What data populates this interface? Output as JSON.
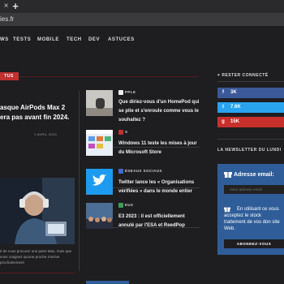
{
  "browser": {
    "tab_close": "×",
    "tab_new": "+",
    "url": "ies.fr"
  },
  "nav": {
    "items": [
      "WS",
      "TESTS",
      "MOBILE",
      "TECH",
      "DEV",
      "ASTUCES"
    ]
  },
  "featured": {
    "section_label": "TUS",
    "title": "asque AirPods Max 2 era pas avant fin 2024.",
    "date": "1 AVRIL 2023",
    "excerpt": "é de vous procurer une paire Max, mais que vous craignez qu'une proche n'arrive prochainement"
  },
  "articles": [
    {
      "category": "PPLE",
      "title": "Que diriez-vous d'un HomePod qui se plie et s'enroule comme vous le souhaitez ?"
    },
    {
      "category": "S",
      "title": "Windows 11 teste les mises à jour du Microsoft Store"
    },
    {
      "category": "ÉSEAUX SOCIAUX",
      "title": "Twitter lance les « Organisations vérifiées » dans le monde entier"
    },
    {
      "category": "EUX",
      "title": "E3 2023 : il est officiellement annulé par l'ESA et ReedPop"
    }
  ],
  "sidebar": {
    "connect_heading": "RESTER CONNECTÉ",
    "social": [
      {
        "icon": "f",
        "count": "3K",
        "color": "#3b5998"
      },
      {
        "icon": "t",
        "count": "7.6K",
        "color": "#2aa3ef"
      },
      {
        "icon": "g",
        "count": "15K",
        "color": "#c8302c"
      }
    ],
    "newsletter_heading": "LA NEWSLETTER DU LUNDI",
    "newsletter_label": "Adresse email:",
    "newsletter_placeholder": "Votre adresse email",
    "consent_text": "En utilisant ce vous acceptez le stock traitement de vos don site Web.",
    "subscribe_label": "ABONNEZ-VOUS"
  },
  "colors": {
    "accent": "#c23030",
    "newsletter_bg": "#2f5d99",
    "page_bg": "#1e1e20"
  }
}
